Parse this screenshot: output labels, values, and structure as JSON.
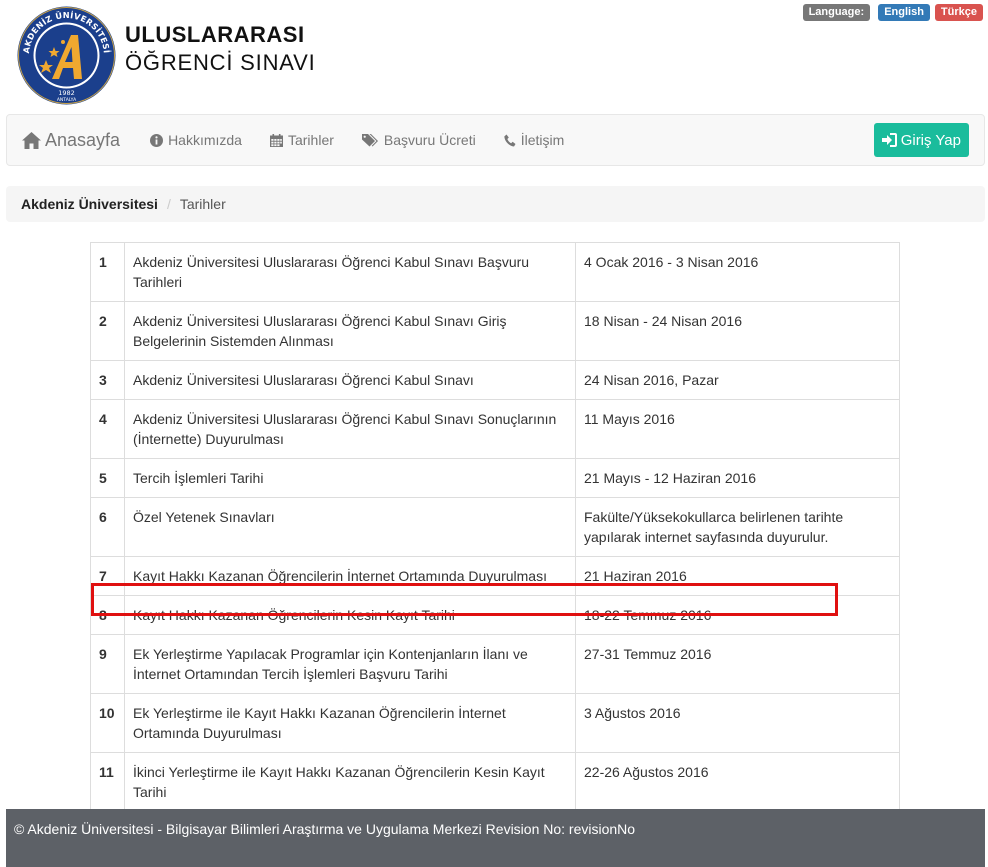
{
  "language": {
    "label": "Language:",
    "english": "English",
    "turkish": "Türkçe"
  },
  "header": {
    "title_line1": "ULUSLARARASI",
    "title_line2": "ÖĞRENCİ SINAVI",
    "logo": {
      "top_text": "AKDENİZ ÜNİVERSİTESİ",
      "year": "1982",
      "city": "ANTALYA",
      "colors": {
        "ring": "#1b3f8c",
        "gold": "#f0a830"
      }
    }
  },
  "nav": {
    "brand": {
      "label": "Anasayfa",
      "icon": "home-icon"
    },
    "items": [
      {
        "label": "Hakkımızda",
        "icon": "info-circle-icon"
      },
      {
        "label": "Tarihler",
        "icon": "calendar-icon"
      },
      {
        "label": "Başvuru Ücreti",
        "icon": "tags-icon"
      },
      {
        "label": "İletişim",
        "icon": "phone-icon"
      }
    ],
    "login": {
      "label": "Giriş Yap",
      "icon": "sign-in-icon",
      "color": "#1abc9c"
    }
  },
  "breadcrumb": {
    "home": "Akdeniz Üniversitesi",
    "separator": "/",
    "current": "Tarihler"
  },
  "table": {
    "rows": [
      {
        "no": "1",
        "event": "Akdeniz Üniversitesi Uluslararası Öğrenci Kabul Sınavı Başvuru Tarihleri",
        "date": "4 Ocak 2016 - 3 Nisan 2016"
      },
      {
        "no": "2",
        "event": "Akdeniz Üniversitesi Uluslararası Öğrenci Kabul Sınavı Giriş Belgelerinin Sistemden Alınması",
        "date": "18 Nisan - 24 Nisan 2016"
      },
      {
        "no": "3",
        "event": "Akdeniz Üniversitesi Uluslararası Öğrenci Kabul Sınavı",
        "date": "24 Nisan 2016, Pazar"
      },
      {
        "no": "4",
        "event": "Akdeniz Üniversitesi Uluslararası Öğrenci Kabul Sınavı Sonuçlarının (İnternette) Duyurulması",
        "date": "11 Mayıs 2016"
      },
      {
        "no": "5",
        "event": "Tercih İşlemleri Tarihi",
        "date": "21 Mayıs - 12 Haziran 2016"
      },
      {
        "no": "6",
        "event": "Özel Yetenek Sınavları",
        "date": "Fakülte/Yüksekokullarca belirlenen tarihte yapılarak internet sayfasında duyurulur."
      },
      {
        "no": "7",
        "event": "Kayıt Hakkı Kazanan Öğrencilerin İnternet Ortamında Duyurulması",
        "date": "21 Haziran 2016"
      },
      {
        "no": "8",
        "event": "Kayıt Hakkı Kazanan Öğrencilerin Kesin Kayıt Tarihi",
        "date": "18-22 Temmuz 2016",
        "highlighted": true
      },
      {
        "no": "9",
        "event": "Ek Yerleştirme Yapılacak Programlar için Kontenjanların İlanı ve İnternet Ortamından Tercih İşlemleri Başvuru Tarihi",
        "date": "27-31 Temmuz 2016"
      },
      {
        "no": "10",
        "event": "Ek Yerleştirme ile Kayıt Hakkı Kazanan Öğrencilerin İnternet Ortamında Duyurulması",
        "date": "3 Ağustos 2016"
      },
      {
        "no": "11",
        "event": "İkinci Yerleştirme ile Kayıt Hakkı Kazanan Öğrencilerin Kesin Kayıt Tarihi",
        "date": "22-26 Ağustos 2016"
      }
    ],
    "highlight_color": "#e01010"
  },
  "footer": {
    "text": "© Akdeniz Üniversitesi - Bilgisayar Bilimleri Araştırma ve Uygulama Merkezi Revision No: revisionNo"
  }
}
